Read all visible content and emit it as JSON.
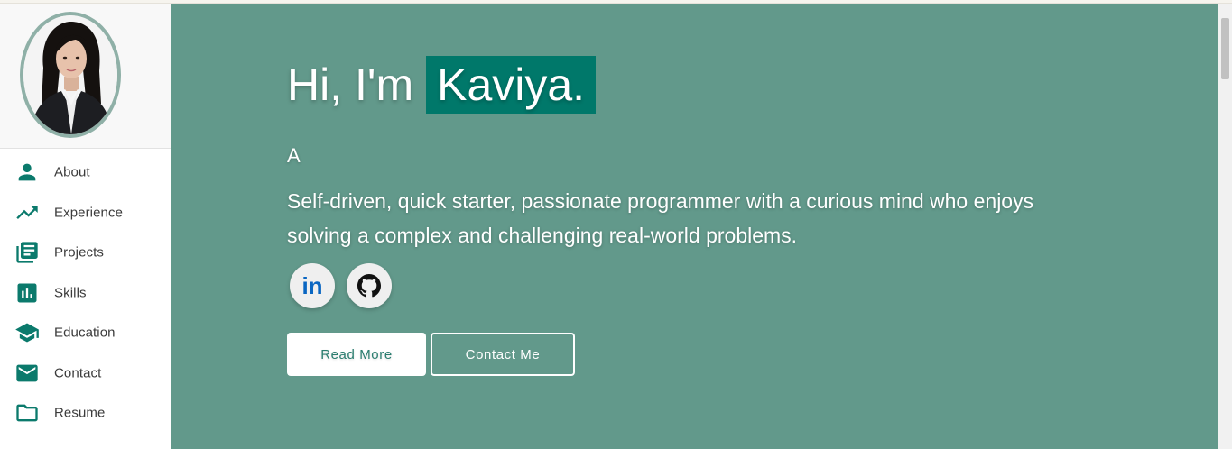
{
  "sidebar": {
    "avatar_alt": "Profile photo of Kaviya",
    "items": [
      {
        "label": "About",
        "icon": "person-icon"
      },
      {
        "label": "Experience",
        "icon": "trending-up-icon"
      },
      {
        "label": "Projects",
        "icon": "library-books-icon"
      },
      {
        "label": "Skills",
        "icon": "bar-chart-icon"
      },
      {
        "label": "Education",
        "icon": "school-icon"
      },
      {
        "label": "Contact",
        "icon": "email-icon"
      },
      {
        "label": "Resume",
        "icon": "folder-icon"
      }
    ]
  },
  "hero": {
    "greeting": "Hi, I'm",
    "name": "Kaviya.",
    "subtitle": "A",
    "description": "Self-driven, quick starter, passionate programmer with a curious mind who enjoys solving a complex and challenging real-world problems."
  },
  "social": {
    "linkedin_label": "in",
    "linkedin_icon": "linkedin-icon",
    "github_icon": "github-icon"
  },
  "buttons": {
    "read_more": "Read More",
    "contact_me": "Contact Me"
  },
  "colors": {
    "accent": "#00786a",
    "hero_background": "#62998b",
    "sidebar_icon": "#0b7a6c",
    "avatar_border": "#8fb0a7"
  }
}
